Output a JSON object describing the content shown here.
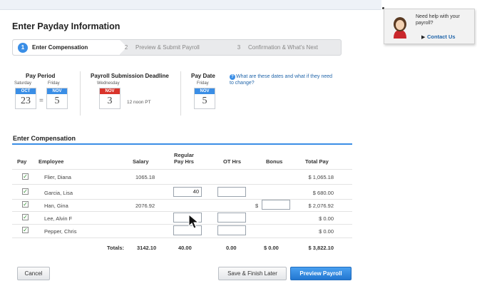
{
  "page": {
    "title": "Enter Payday Information"
  },
  "help": {
    "question": "Need help with your payroll?",
    "contact_label": "Contact Us"
  },
  "steps": [
    {
      "number": "1",
      "label": "Enter Compensation",
      "active": true
    },
    {
      "number": "2",
      "label": "Preview & Submit Payroll",
      "active": false
    },
    {
      "number": "3",
      "label": "Confirmation & What's Next",
      "active": false
    }
  ],
  "dates": {
    "pay_period": {
      "label": "Pay Period",
      "start": {
        "weekday": "Saturday",
        "month": "OCT",
        "day": "23"
      },
      "end": {
        "weekday": "Friday",
        "month": "NOV",
        "day": "5"
      }
    },
    "deadline": {
      "label": "Payroll Submission Deadline",
      "weekday": "Wednesday",
      "month": "NOV",
      "day": "3",
      "time": "12 noon PT"
    },
    "pay_date": {
      "label": "Pay Date",
      "weekday": "Friday",
      "month": "NOV",
      "day": "5"
    },
    "info_link": "What are these dates and what if they need to change?"
  },
  "compensation": {
    "title": "Enter Compensation",
    "headers": {
      "pay": "Pay",
      "employee": "Employee",
      "salary": "Salary",
      "regular": "Regular Pay Hrs",
      "ot": "OT Hrs",
      "bonus": "Bonus",
      "total": "Total Pay"
    },
    "rows": [
      {
        "name": "Flier, Diana",
        "salary": "1065.18",
        "regular": "",
        "ot": "",
        "bonus": "",
        "total": "$ 1,065.18"
      },
      {
        "name": "Garcia, Lisa",
        "salary": "",
        "regular": "40",
        "ot": "",
        "bonus": "",
        "total": "$ 680.00"
      },
      {
        "name": "Han, Gina",
        "salary": "2076.92",
        "regular": "",
        "ot": "",
        "bonus": "",
        "total": "$ 2,076.92"
      },
      {
        "name": "Lee, Alvin F",
        "salary": "",
        "regular": "",
        "ot": "",
        "bonus": "",
        "total": "$ 0.00"
      },
      {
        "name": "Pepper, Chris",
        "salary": "",
        "regular": "",
        "ot": "",
        "bonus": "",
        "total": "$ 0.00"
      }
    ],
    "bonus_currency": "$",
    "totals": {
      "label": "Totals:",
      "salary": "3142.10",
      "regular": "40.00",
      "ot": "0.00",
      "bonus": "$ 0.00",
      "total": "$ 3,822.10"
    }
  },
  "buttons": {
    "cancel": "Cancel",
    "save": "Save & Finish Later",
    "preview": "Preview Payroll"
  },
  "colors": {
    "accent": "#3a8ee6",
    "deadline_red": "#d9342b",
    "link": "#2266aa"
  }
}
